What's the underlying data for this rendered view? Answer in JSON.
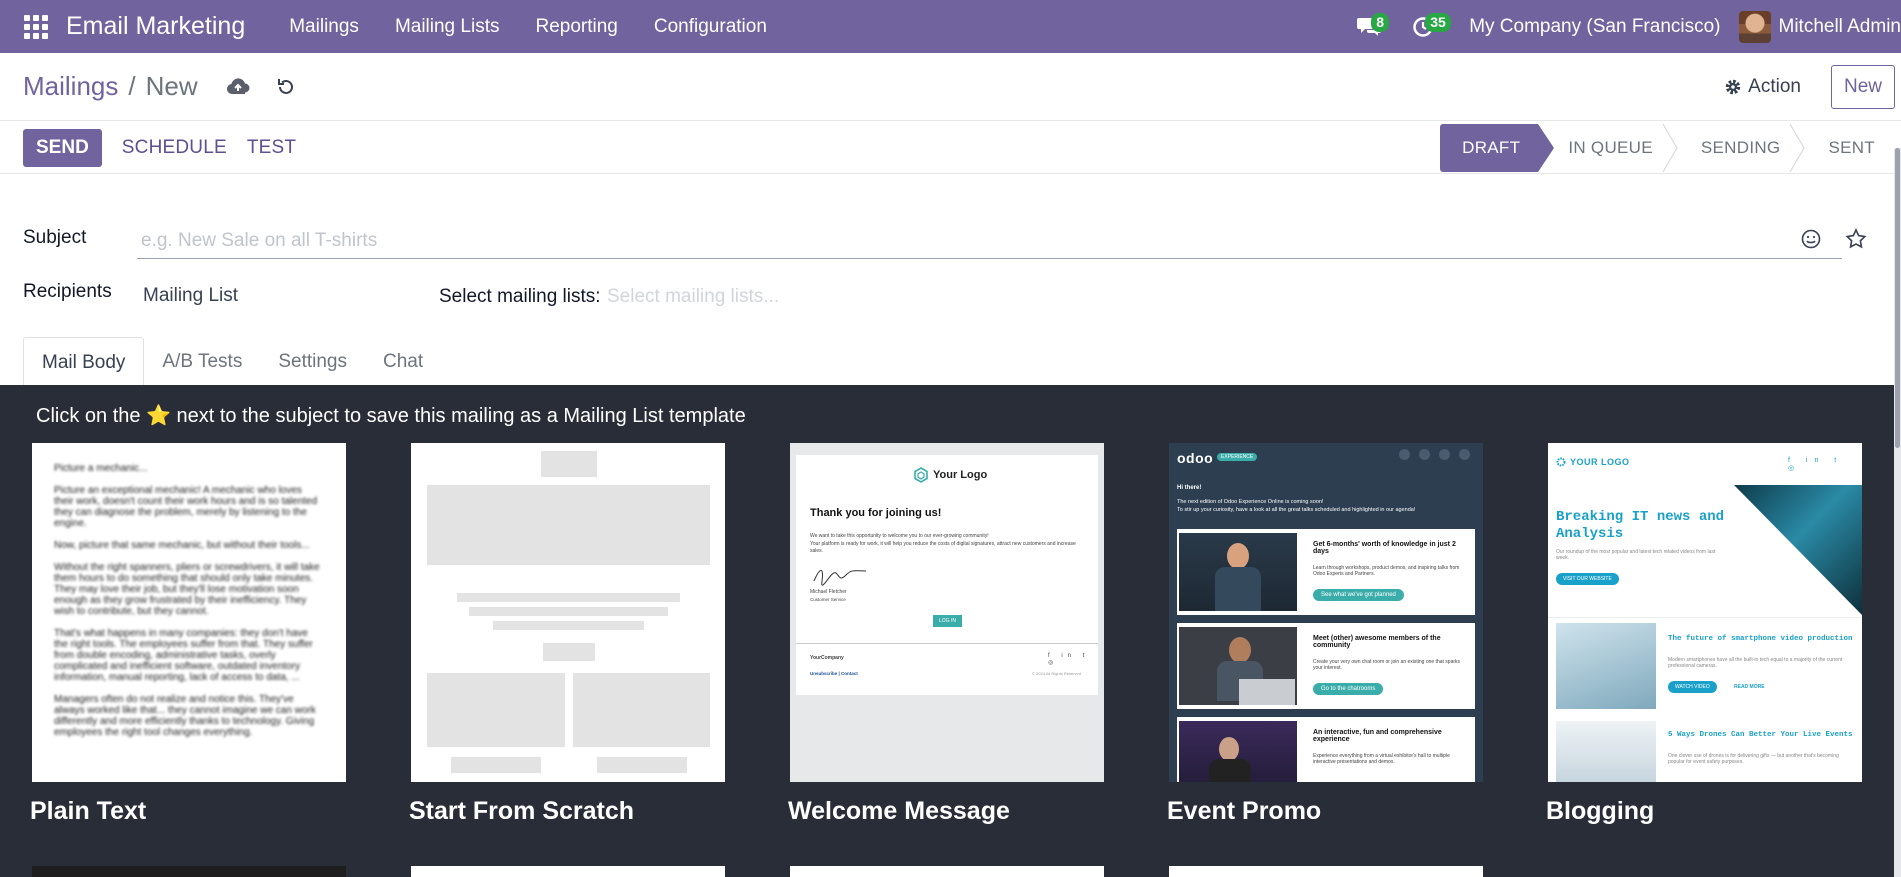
{
  "topnav": {
    "app_title": "Email Marketing",
    "menu": [
      "Mailings",
      "Mailing Lists",
      "Reporting",
      "Configuration"
    ],
    "messages_count": "8",
    "activities_count": "35",
    "company": "My Company (San Francisco)",
    "user": "Mitchell Admin"
  },
  "control_panel": {
    "breadcrumb_parent": "Mailings",
    "breadcrumb_separator": "/",
    "breadcrumb_current": "New",
    "action_label": "Action",
    "new_label": "New"
  },
  "statusbar": {
    "send_label": "SEND",
    "schedule_label": "SCHEDULE",
    "test_label": "TEST",
    "stages": [
      "DRAFT",
      "IN QUEUE",
      "SENDING",
      "SENT"
    ],
    "active_stage": "DRAFT"
  },
  "form": {
    "subject_label": "Subject",
    "subject_placeholder": "e.g. New Sale on all T-shirts",
    "recipients_label": "Recipients",
    "recipients_value": "Mailing List",
    "select_lists_label": "Select mailing lists:",
    "select_lists_placeholder": "Select mailing lists..."
  },
  "tabs": [
    "Mail Body",
    "A/B Tests",
    "Settings",
    "Chat"
  ],
  "templates": {
    "hint": "Click on the ⭐ next to the subject to save this mailing as a Mailing List template",
    "items": [
      {
        "name": "Plain Text"
      },
      {
        "name": "Start From Scratch"
      },
      {
        "name": "Welcome Message"
      },
      {
        "name": "Event Promo"
      },
      {
        "name": "Blogging"
      }
    ],
    "plain_text_preview": [
      "Picture a mechanic...",
      "Picture an exceptional mechanic! A mechanic who loves their work, doesn't count their work hours and is so talented they can diagnose the problem, merely by listening to the engine.",
      "Now, picture that same mechanic, but without their tools...",
      "Without the right spanners, pliers or screwdrivers, it will take them hours to do something that should only take minutes. They may love their job, but they'll lose motivation soon enough as they grow frustrated by their inefficiency. They wish to contribute, but they cannot.",
      "That's what happens in many companies: they don't have the right tools. The employees suffer from that. They suffer from double encoding, administrative tasks, overly complicated and inefficient software, outdated inventory information, manual reporting, lack of access to data, ...",
      "Managers often do not realize and notice this. They've always worked like that... they cannot imagine we can work differently and more efficiently thanks to technology. Giving employees the right tool changes everything."
    ],
    "welcome": {
      "logo": "Your Logo",
      "heading": "Thank you for joining us!",
      "body1": "We want to take this opportunity to welcome you to our ever-growing community!",
      "body2": "Your platform is ready for work, it will help you reduce the costs of digital signatures, attract new customers and increase sales.",
      "signer": "Michael Fletcher",
      "signer_role": "Customer Service",
      "login": "LOG IN",
      "company": "YourCompany",
      "footer_links": "Unsubscribe | Contact",
      "rights": "© 2024 All Rights Reserved"
    },
    "event": {
      "logo": "odoo",
      "tag": "EXPERIENCE",
      "hi": "Hi there!",
      "intro1": "The next edition of Odoo Experience Online is coming soon!",
      "intro2": "To stir up your curiosity, have a look at all the great talks scheduled and highlighted in our agenda!",
      "rows": [
        {
          "title": "Get 6-months' worth of knowledge in just 2 days",
          "text": "Learn through workshops, product demos, and inspiring talks from Odoo Experts and Partners.",
          "cta": "See what we've got planned"
        },
        {
          "title": "Meet (other) awesome members of the community",
          "text": "Create your very own chat room or join an existing one that sparks your interest.",
          "cta": "Go to the chatrooms"
        },
        {
          "title": "An interactive, fun and comprehensive experience",
          "text": "Experience everything from a virtual exhibitor's hall to multiple interactive presentations and demos.",
          "cta": ""
        }
      ]
    },
    "blog": {
      "logo": "YOUR LOGO",
      "headline": "Breaking IT news and Analysis",
      "sub": "Our roundup of the most popular and latest tech related videos from last week.",
      "cta": "VISIT OUR WEBSITE",
      "post1_title": "The future of smartphone video production",
      "post1_text": "Modern smartphones have all the built-in tech equal to a majority of the current professional cameras.",
      "post1_cta": "WATCH VIDEO",
      "post1_more": "READ MORE",
      "post2_title": "5 Ways Drones Can Better Your Live Events",
      "post2_text": "One clever use of drones is for delivering gifts — but another that's becoming popular for event safety purposes."
    }
  },
  "colors": {
    "brand": "#71639e",
    "panel_bg": "#292d37",
    "badge_green": "#28a745"
  }
}
